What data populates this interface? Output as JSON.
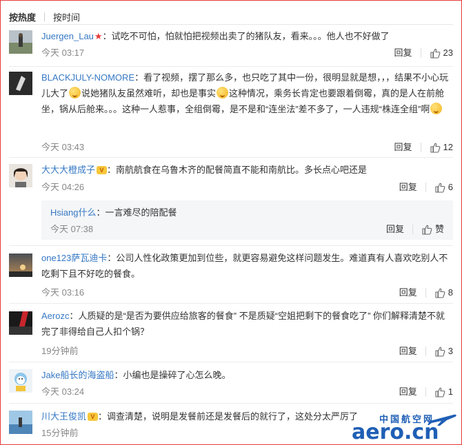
{
  "tabs": {
    "hot": "按热度",
    "time": "按时间"
  },
  "labels": {
    "reply": "回复",
    "like": "赞"
  },
  "comments": [
    {
      "name": "Juergen_Lau",
      "text": "：试吃不可怕，怕就怕把视频出卖了的猪队友，看来。。。他人也不好做了",
      "time": "今天 03:17",
      "likes": "23"
    },
    {
      "name": "BLACKJULY-NOMORE",
      "text_1": "：看了视频，摆了那么多，也只吃了其中一份，很明显就是想，，，结果不小心玩儿大了",
      "text_2": "说她猪队友虽然难听，却也是事实",
      "text_3": "这种情况，乘务长肯定也要跟着倒霉，真的是人在前舱坐，锅从后舱来。。。这种一人惹事，全组倒霉，是不是和“连坐法”差不多了，一人违规“株连全组”啊",
      "time": "今天 03:43",
      "likes": "12"
    },
    {
      "name": "大大大橙成子",
      "text": "：南航航食在乌鲁木齐的配餐简直不能和南航比。多长点心吧还是",
      "time": "今天 04:26",
      "likes": "6"
    },
    {
      "name": "Hsiang什么",
      "text": "：一言难尽的陪配餐",
      "time": "今天 07:38",
      "likes": "赞"
    },
    {
      "name": "one123萨瓦迪卡",
      "text": "：公司人性化政策更加到位些，就更容易避免这样问题发生。难道真有人喜欢吃别人不吃剩下且不好吃的餐食。",
      "time": "今天 03:16",
      "likes": "8"
    },
    {
      "name": "Aerozc",
      "text": "：人质疑的是“是否为要供应给旅客的餐食” 不是质疑“空姐把剩下的餐食吃了” 你们解释清楚不就完了非得给自己人扣个锅？",
      "time": "19分钟前",
      "likes": "3"
    },
    {
      "name": "Jake船长的海盗船",
      "text": "：小编也是操碎了心怎么晚。",
      "time": "今天 03:24",
      "likes": "1"
    },
    {
      "name": "川大王俊凯",
      "text": "：调查清楚，说明是发餐前还是发餐后的就行了，这处分太严厉了",
      "time": "15分钟前",
      "likes": ""
    }
  ],
  "watermark": {
    "top": "中国航空网",
    "main": "aero.cn"
  },
  "colors": {
    "name": "#3578c4",
    "border": "#e53a3a",
    "watermark": "#1f5fb5"
  }
}
